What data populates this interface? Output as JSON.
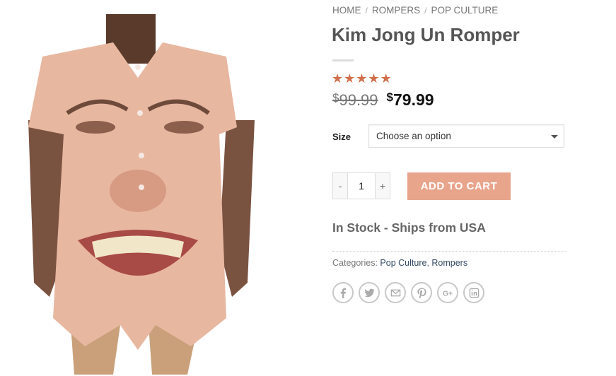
{
  "breadcrumb": {
    "items": [
      "HOME",
      "ROMPERS",
      "POP CULTURE"
    ],
    "separator": "/"
  },
  "product": {
    "title": "Kim Jong Un Romper",
    "rating": 5,
    "rating_max": 5,
    "price_old_currency": "$",
    "price_old": "99.99",
    "price_new_currency": "$",
    "price_new": "79.99",
    "stock": "In Stock - Ships from USA"
  },
  "size": {
    "label": "Size",
    "selected": "Choose an option"
  },
  "quantity": {
    "minus": "-",
    "value": "1",
    "plus": "+"
  },
  "cart": {
    "label": "ADD TO CART"
  },
  "categories": {
    "label": "Categories:",
    "items": [
      "Pop Culture",
      "Rompers"
    ]
  },
  "share_icons": [
    "facebook-icon",
    "twitter-icon",
    "email-icon",
    "pinterest-icon",
    "google-plus-icon",
    "linkedin-icon"
  ],
  "colors": {
    "accent": "#d26e4b",
    "button": "#e8a58c",
    "link": "#334862"
  }
}
